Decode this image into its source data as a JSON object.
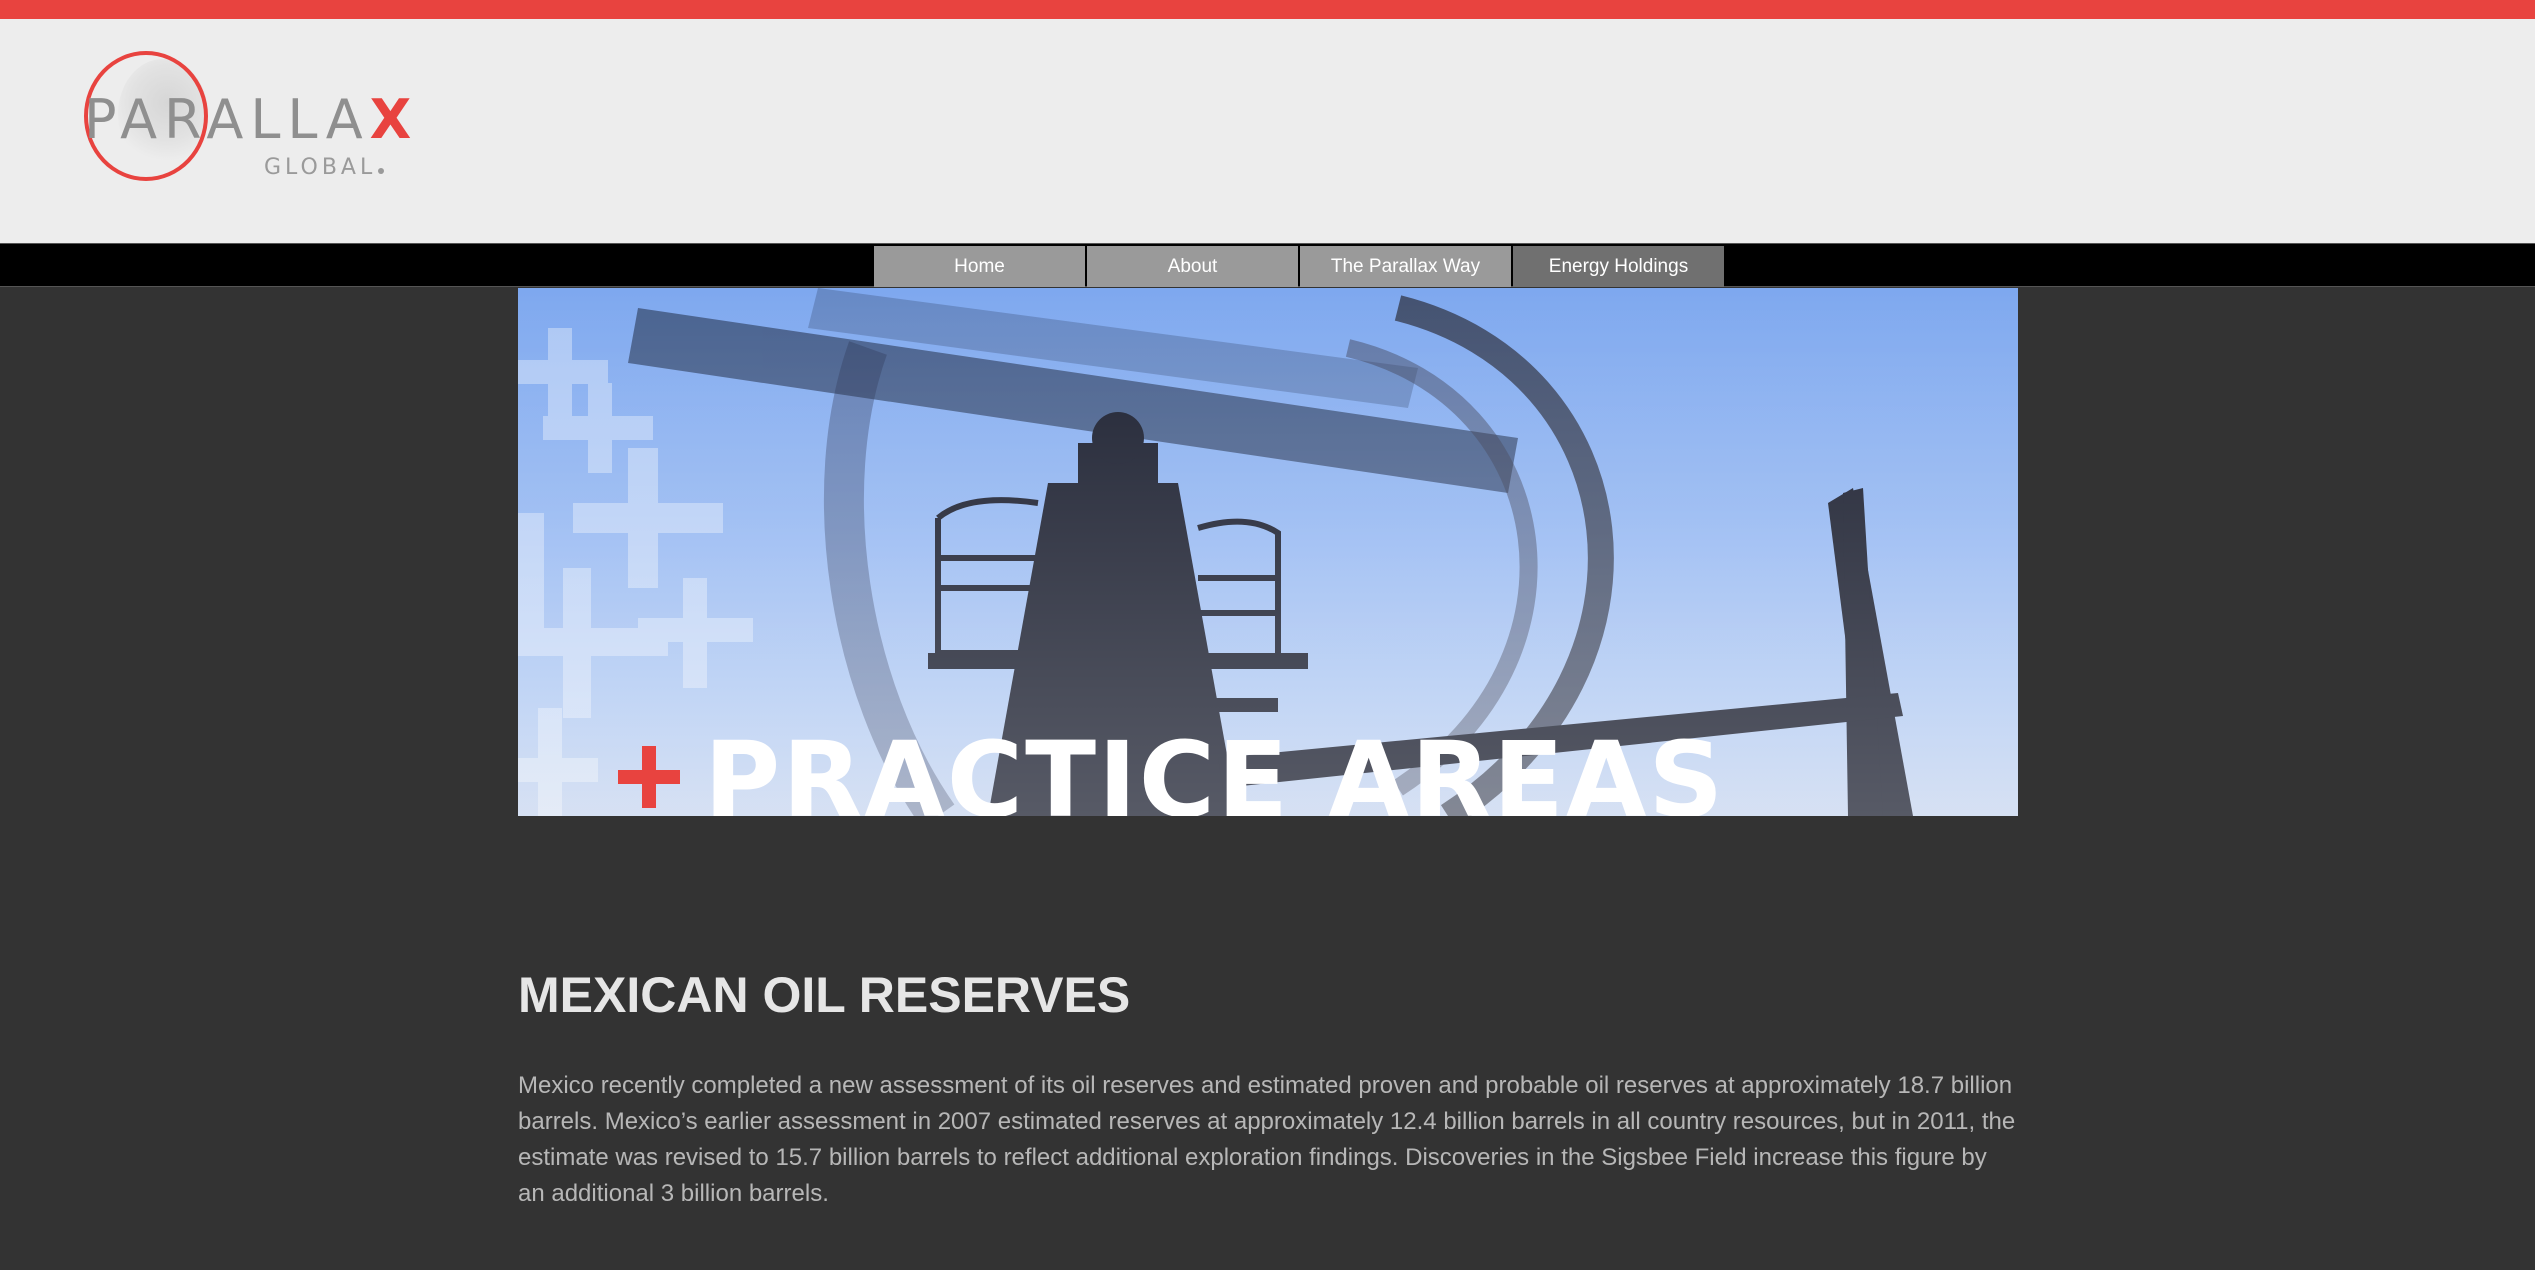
{
  "brand": {
    "name_main": "PARALLA",
    "name_accent": "X",
    "name_sub": "GLOBAL",
    "accent_color": "#e8433f",
    "logo_text_color": "#8f8f8f"
  },
  "nav": {
    "items": [
      {
        "label": "Home"
      },
      {
        "label": "About"
      },
      {
        "label": "The Parallax Way"
      },
      {
        "label": "Energy Holdings"
      }
    ],
    "active_index": 3
  },
  "hero": {
    "title": "PRACTICE AREAS",
    "plus_icon": "plus-icon",
    "image": "oil-pumpjack-silhouette-against-blue-sky"
  },
  "article": {
    "heading": "MEXICAN OIL RESERVES",
    "body": "Mexico recently completed a new assessment of its oil reserves and estimated proven and probable oil reserves at approximately 18.7 billion barrels. Mexico’s earlier assessment in 2007 estimated reserves at approximately 12.4 billion barrels in all country resources, but in 2011, the estimate was revised to 15.7 billion barrels to reflect additional exploration findings. Discoveries in the Sigsbee Field increase this figure by an additional 3 billion barrels."
  },
  "colors": {
    "page_background": "#333333",
    "header_background": "#ededed",
    "navbar_background": "#000000",
    "nav_item": "#9a9a9a",
    "nav_item_active": "#707070"
  }
}
